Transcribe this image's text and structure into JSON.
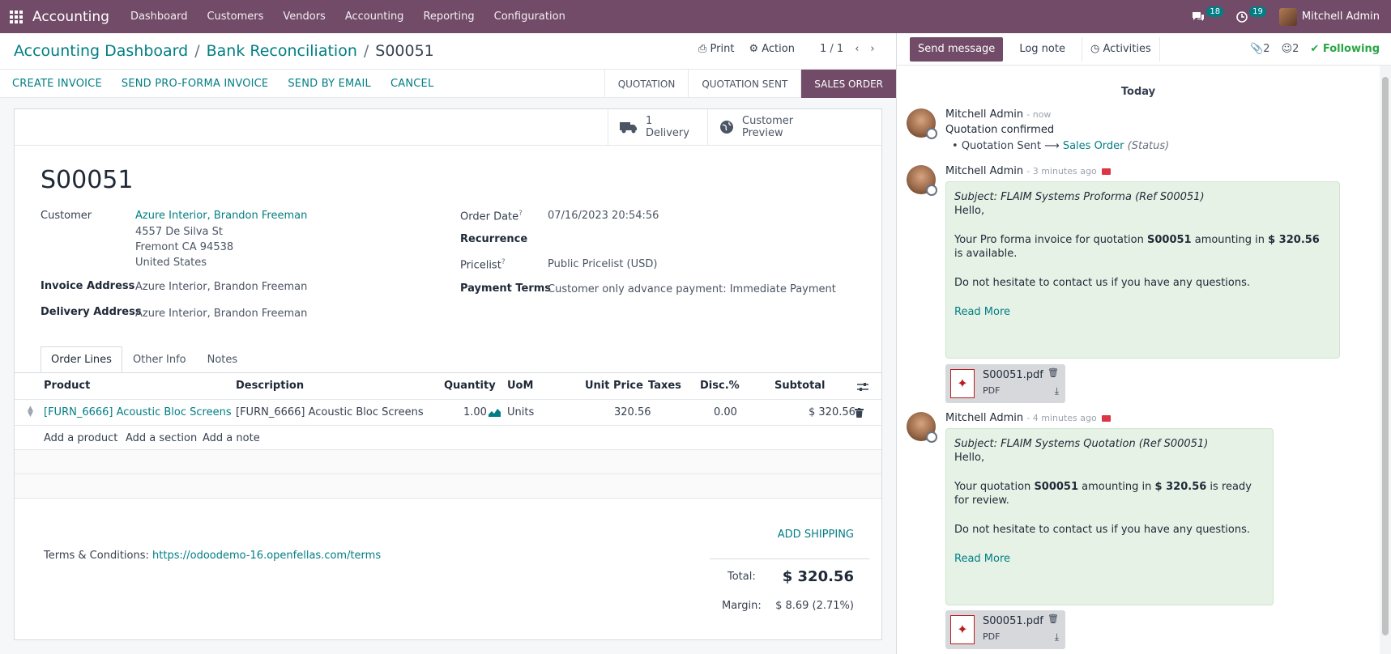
{
  "topbar": {
    "app_name": "Accounting",
    "menu": [
      "Dashboard",
      "Customers",
      "Vendors",
      "Accounting",
      "Reporting",
      "Configuration"
    ],
    "messages_count": "18",
    "activities_count": "19",
    "user_name": "Mitchell Admin"
  },
  "breadcrumb": {
    "level1": "Accounting Dashboard",
    "level2": "Bank Reconciliation",
    "current": "S00051",
    "sep": "/"
  },
  "actions": {
    "print": "Print",
    "action": "Action",
    "pager": "1 / 1"
  },
  "statusbar": {
    "buttons": [
      "CREATE INVOICE",
      "SEND PRO-FORMA INVOICE",
      "SEND BY EMAIL",
      "CANCEL"
    ],
    "stages": [
      "QUOTATION",
      "QUOTATION SENT",
      "SALES ORDER"
    ]
  },
  "smart_buttons": {
    "delivery_count": "1",
    "delivery_label": "Delivery",
    "preview_line1": "Customer",
    "preview_line2": "Preview"
  },
  "form": {
    "name": "S00051",
    "customer_label": "Customer",
    "customer": "Azure Interior, Brandon Freeman",
    "address1": "4557 De Silva St",
    "address2": "Fremont CA 94538",
    "address3": "United States",
    "invoice_address_label": "Invoice Address",
    "invoice_address": "Azure Interior, Brandon Freeman",
    "delivery_address_label": "Delivery Address",
    "delivery_address": "Azure Interior, Brandon Freeman",
    "order_date_label": "Order Date",
    "order_date": "07/16/2023 20:54:56",
    "recurrence_label": "Recurrence",
    "pricelist_label": "Pricelist",
    "pricelist": "Public Pricelist (USD)",
    "payment_terms_label": "Payment Terms",
    "payment_terms": "Customer only advance payment: Immediate Payment",
    "help_mark": "?"
  },
  "tabs": [
    "Order Lines",
    "Other Info",
    "Notes"
  ],
  "lines": {
    "columns": {
      "product": "Product",
      "description": "Description",
      "quantity": "Quantity",
      "uom": "UoM",
      "unit_price": "Unit Price",
      "taxes": "Taxes",
      "disc": "Disc.%",
      "subtotal": "Subtotal"
    },
    "rows": [
      {
        "product": "[FURN_6666] Acoustic Bloc Screens",
        "description": "[FURN_6666] Acoustic Bloc Screens",
        "quantity": "1.00",
        "uom": "Units",
        "unit_price": "320.56",
        "taxes": "",
        "disc": "0.00",
        "subtotal": "$ 320.56"
      }
    ],
    "add_product": "Add a product",
    "add_section": "Add a section",
    "add_note": "Add a note"
  },
  "footer": {
    "terms_label": "Terms & Conditions:",
    "terms_link": "https://odoodemo-16.openfellas.com/terms",
    "add_shipping": "ADD SHIPPING",
    "total_label": "Total:",
    "total": "$ 320.56",
    "margin_label": "Margin:",
    "margin": "$ 8.69 (2.71%)"
  },
  "chatter": {
    "send_message": "Send message",
    "log_note": "Log note",
    "activities": "Activities",
    "attachments_count": "2",
    "followers_count": "2",
    "following": "Following",
    "today": "Today",
    "messages": [
      {
        "author": "Mitchell Admin",
        "time": "- now",
        "body": "Quotation confirmed",
        "tracking_from": "Quotation Sent",
        "tracking_to": "Sales Order",
        "tracking_field": "(Status)"
      },
      {
        "author": "Mitchell Admin",
        "time": "- 3 minutes ago",
        "subject": "Subject: FLAIM Systems Proforma (Ref S00051)",
        "greeting": "Hello,",
        "line_a": "Your Pro forma invoice for quotation ",
        "ref": "S00051",
        "line_b": " amounting in ",
        "amount": "$ 320.56",
        "line_c": " is available.",
        "closing": "Do not hesitate to contact us if you have any questions.",
        "read_more": "Read More",
        "attachment_name": "S00051.pdf",
        "attachment_type": "PDF"
      },
      {
        "author": "Mitchell Admin",
        "time": "- 4 minutes ago",
        "subject": "Subject: FLAIM Systems Quotation (Ref S00051)",
        "greeting": "Hello,",
        "line_a": "Your quotation ",
        "ref": "S00051",
        "line_b": " amounting in ",
        "amount": "$ 320.56",
        "line_c": " is ready for review.",
        "closing": "Do not hesitate to contact us if you have any questions.",
        "read_more": "Read More",
        "attachment_name": "S00051.pdf",
        "attachment_type": "PDF"
      }
    ]
  },
  "colors": {
    "brand": "#714b67",
    "accent": "#017e84",
    "note_bg": "#e6f2e6",
    "following": "#28a745"
  }
}
